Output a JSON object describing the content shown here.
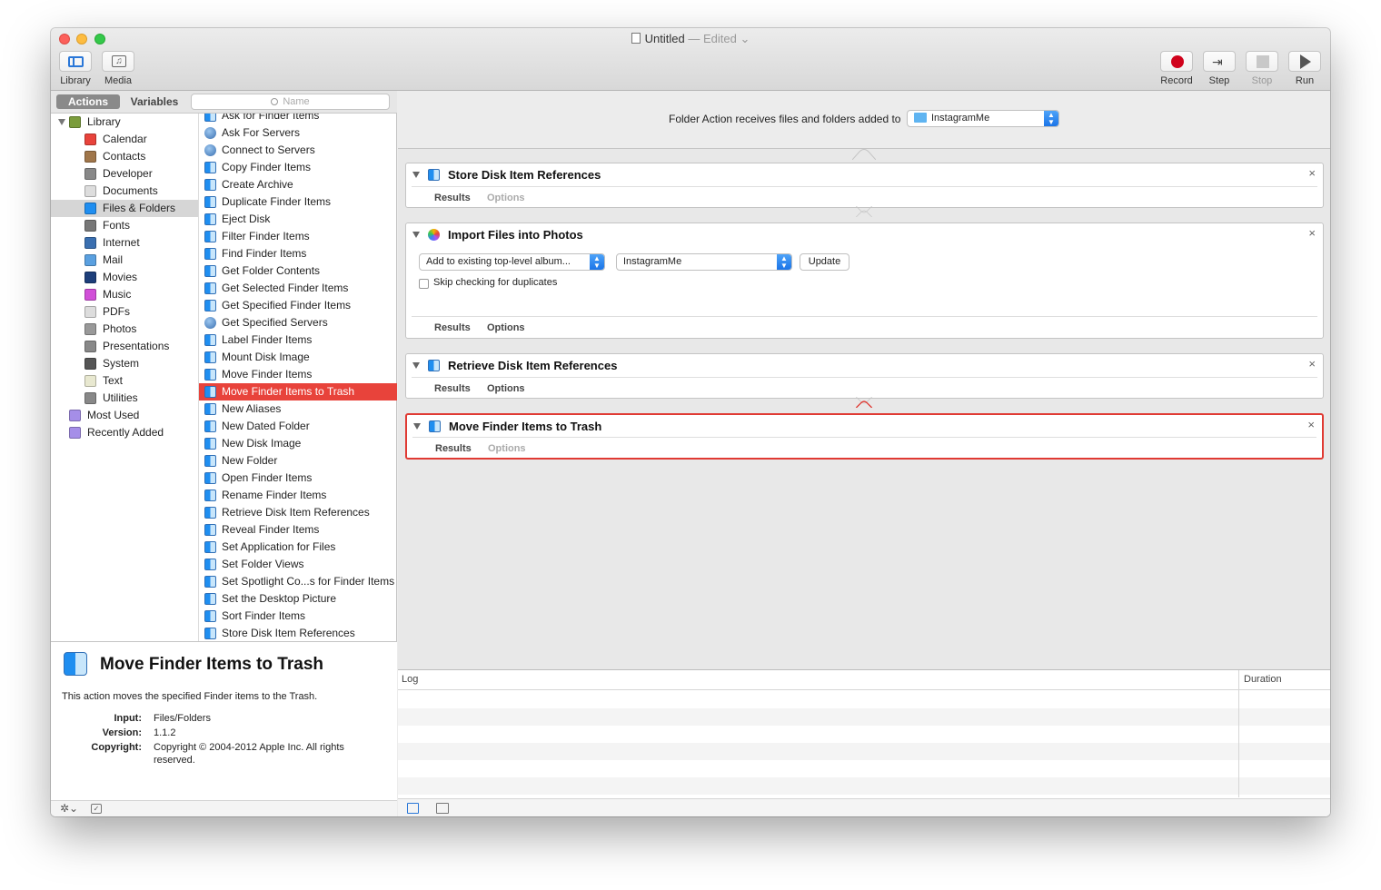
{
  "window": {
    "title": "Untitled",
    "separator": "— Edited",
    "chevron": "⌄"
  },
  "toolbar": {
    "library_label": "Library",
    "media_label": "Media",
    "media_icon": "♫",
    "record_label": "Record",
    "step_label": "Step",
    "step_icon": "⇥",
    "stop_label": "Stop",
    "run_label": "Run"
  },
  "left_header": {
    "actions_tab": "Actions",
    "variables_tab": "Variables",
    "search_placeholder": "Name"
  },
  "library": [
    {
      "label": "Library",
      "color": "#7a9c3b"
    },
    {
      "label": "Calendar",
      "color": "#e8433b"
    },
    {
      "label": "Contacts",
      "color": "#a0764a"
    },
    {
      "label": "Developer",
      "color": "#888888"
    },
    {
      "label": "Documents",
      "color": "#dddddd"
    },
    {
      "label": "Files & Folders",
      "color": "#1f8ef0"
    },
    {
      "label": "Fonts",
      "color": "#777777"
    },
    {
      "label": "Internet",
      "color": "#3a6fb0"
    },
    {
      "label": "Mail",
      "color": "#5aa0e0"
    },
    {
      "label": "Movies",
      "color": "#1d3e7a"
    },
    {
      "label": "Music",
      "color": "#d14fd8"
    },
    {
      "label": "PDFs",
      "color": "#dddddd"
    },
    {
      "label": "Photos",
      "color": "#999999"
    },
    {
      "label": "Presentations",
      "color": "#888888"
    },
    {
      "label": "System",
      "color": "#555555"
    },
    {
      "label": "Text",
      "color": "#e8e8d0"
    },
    {
      "label": "Utilities",
      "color": "#888888"
    },
    {
      "label": "Most Used",
      "color": "#a58ee8"
    },
    {
      "label": "Recently Added",
      "color": "#a58ee8"
    }
  ],
  "actions": [
    {
      "label": "Ask for Finder Items",
      "icon": "finder"
    },
    {
      "label": "Ask For Servers",
      "icon": "globe"
    },
    {
      "label": "Connect to Servers",
      "icon": "globe"
    },
    {
      "label": "Copy Finder Items",
      "icon": "finder"
    },
    {
      "label": "Create Archive",
      "icon": "finder"
    },
    {
      "label": "Duplicate Finder Items",
      "icon": "finder"
    },
    {
      "label": "Eject Disk",
      "icon": "finder"
    },
    {
      "label": "Filter Finder Items",
      "icon": "finder"
    },
    {
      "label": "Find Finder Items",
      "icon": "finder"
    },
    {
      "label": "Get Folder Contents",
      "icon": "finder"
    },
    {
      "label": "Get Selected Finder Items",
      "icon": "finder"
    },
    {
      "label": "Get Specified Finder Items",
      "icon": "finder"
    },
    {
      "label": "Get Specified Servers",
      "icon": "globe"
    },
    {
      "label": "Label Finder Items",
      "icon": "finder"
    },
    {
      "label": "Mount Disk Image",
      "icon": "finder"
    },
    {
      "label": "Move Finder Items",
      "icon": "finder"
    },
    {
      "label": "Move Finder Items to Trash",
      "icon": "finder"
    },
    {
      "label": "New Aliases",
      "icon": "finder"
    },
    {
      "label": "New Dated Folder",
      "icon": "finder"
    },
    {
      "label": "New Disk Image",
      "icon": "finder"
    },
    {
      "label": "New Folder",
      "icon": "finder"
    },
    {
      "label": "Open Finder Items",
      "icon": "finder"
    },
    {
      "label": "Rename Finder Items",
      "icon": "finder"
    },
    {
      "label": "Retrieve Disk Item References",
      "icon": "finder"
    },
    {
      "label": "Reveal Finder Items",
      "icon": "finder"
    },
    {
      "label": "Set Application for Files",
      "icon": "finder"
    },
    {
      "label": "Set Folder Views",
      "icon": "finder"
    },
    {
      "label": "Set Spotlight Co...s for Finder Items",
      "icon": "finder"
    },
    {
      "label": "Set the Desktop Picture",
      "icon": "finder"
    },
    {
      "label": "Sort Finder Items",
      "icon": "finder"
    },
    {
      "label": "Store Disk Item References",
      "icon": "finder"
    }
  ],
  "description": {
    "title": "Move Finder Items to Trash",
    "text": "This action moves the specified Finder items to the Trash.",
    "input_label": "Input:",
    "input_value": "Files/Folders",
    "version_label": "Version:",
    "version_value": "1.1.2",
    "copyright_label": "Copyright:",
    "copyright_value": "Copyright © 2004-2012 Apple Inc.  All rights reserved."
  },
  "left_footer": {
    "gear": "✲⌄",
    "box": "✓"
  },
  "workflow_header": {
    "label": "Folder Action receives files and folders added to",
    "folder": "InstagramMe"
  },
  "cards": {
    "store": {
      "title": "Store Disk Item References",
      "results": "Results",
      "options": "Options",
      "close": "×"
    },
    "import": {
      "title": "Import Files into Photos",
      "album_mode": "Add to existing top-level album...",
      "album": "InstagramMe",
      "update": "Update",
      "skip_dup": "Skip checking for duplicates",
      "results": "Results",
      "options": "Options",
      "close": "×"
    },
    "retrieve": {
      "title": "Retrieve Disk Item References",
      "results": "Results",
      "options": "Options",
      "close": "×"
    },
    "trash": {
      "title": "Move Finder Items to Trash",
      "results": "Results",
      "options": "Options",
      "close": "×"
    }
  },
  "log": {
    "col_log": "Log",
    "col_duration": "Duration"
  },
  "colors": {
    "accent_red": "#e8433b",
    "selection_blue": "#1a74e8"
  }
}
